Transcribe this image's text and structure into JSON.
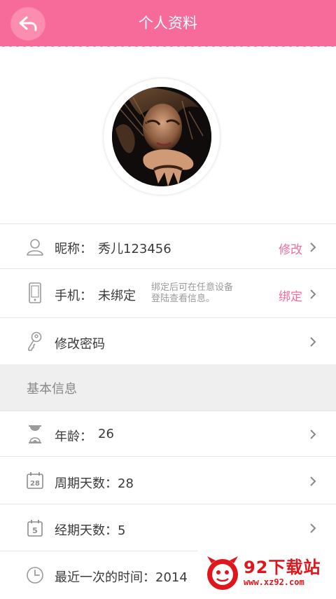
{
  "header": {
    "title": "个人资料"
  },
  "profile": {
    "nickname_label": "昵称：",
    "nickname_value": "秀儿123456",
    "nickname_action": "修改",
    "phone_label": "手机：",
    "phone_value": "未绑定",
    "phone_note": "绑定后可在任意设备登陆查看信息。",
    "phone_action": "绑定",
    "password_label": "修改密码"
  },
  "basic": {
    "section_title": "基本信息",
    "age_label": "年龄：",
    "age_value": "26",
    "cycle_label": "周期天数：28",
    "period_label": "经期天数：5",
    "last_label": "最近一次的时间：2014",
    "cycle_icon_text": "28",
    "period_icon_text": "5"
  },
  "watermark": {
    "name": "92下载站",
    "url": "www.xz92.com"
  },
  "colors": {
    "accent": "#f76b9a",
    "section_bg": "#efefef",
    "watermark": "#e0161d"
  },
  "icons": [
    "back-icon",
    "user-icon",
    "phone-icon",
    "key-icon",
    "hourglass-icon",
    "calendar-28-icon",
    "calendar-5-icon",
    "clock-icon",
    "chevron-right-icon"
  ]
}
